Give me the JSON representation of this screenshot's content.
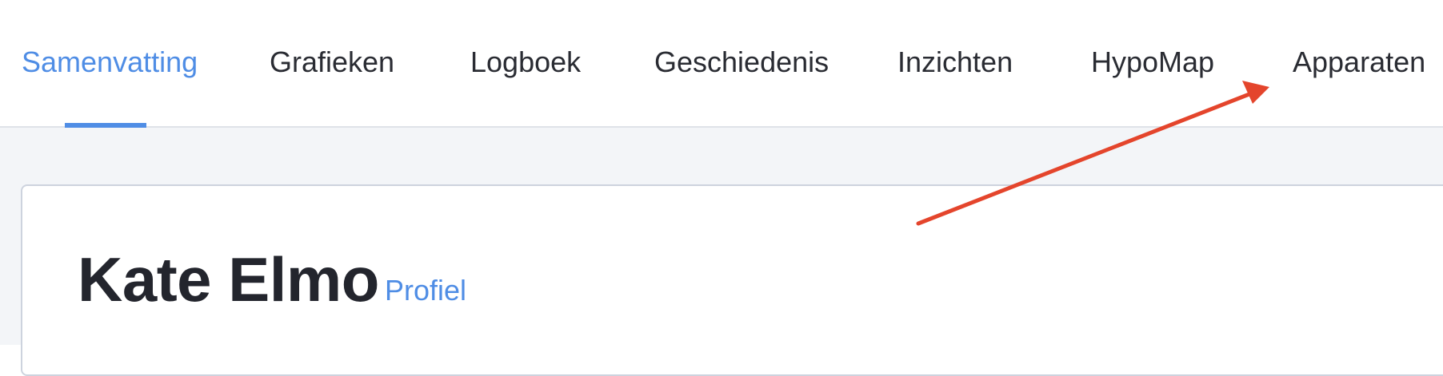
{
  "nav": {
    "tabs": [
      {
        "label": "Samenvatting",
        "active": true
      },
      {
        "label": "Grafieken",
        "active": false
      },
      {
        "label": "Logboek",
        "active": false
      },
      {
        "label": "Geschiedenis",
        "active": false
      },
      {
        "label": "Inzichten",
        "active": false
      },
      {
        "label": "HypoMap",
        "active": false
      },
      {
        "label": "Apparaten",
        "active": false
      }
    ]
  },
  "patient": {
    "name": "Kate Elmo",
    "profile_link": "Profiel"
  },
  "colors": {
    "accent": "#4f8de5",
    "text": "#2a2c33",
    "heading": "#23252d",
    "page_bg": "#f3f5f8",
    "annotation_arrow": "#e4452c"
  },
  "annotation": {
    "type": "arrow",
    "points_to": "Apparaten"
  }
}
